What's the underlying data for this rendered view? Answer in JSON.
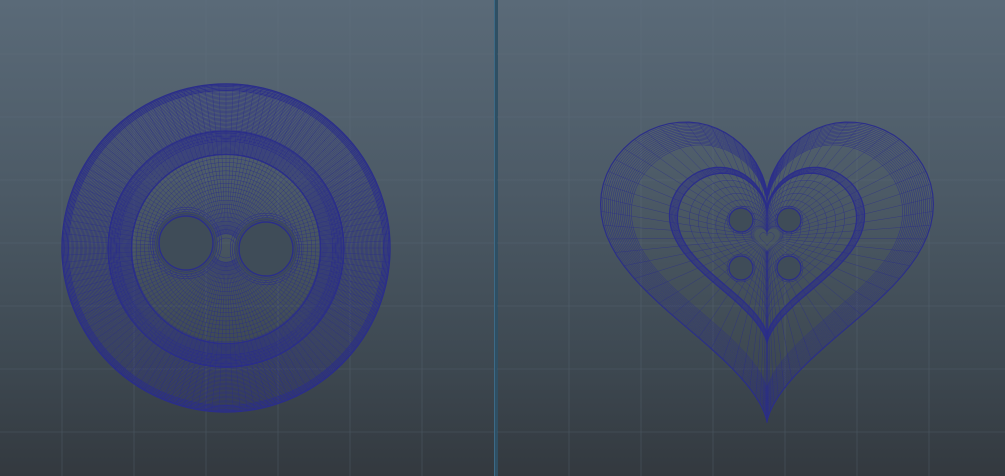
{
  "app": {
    "layout": "two-pane-3d-viewport"
  },
  "viewports": [
    {
      "object": "round-button-mesh",
      "display_mode": "wireframe",
      "holes": 2
    },
    {
      "object": "heart-button-mesh",
      "display_mode": "wireframe",
      "holes": 4
    }
  ],
  "colors": {
    "wireframe": "#2b2e8a",
    "grid": "#647483",
    "divider": "#2f4f63",
    "bg_top": "#5a6a78",
    "bg_bottom": "#33393f"
  }
}
